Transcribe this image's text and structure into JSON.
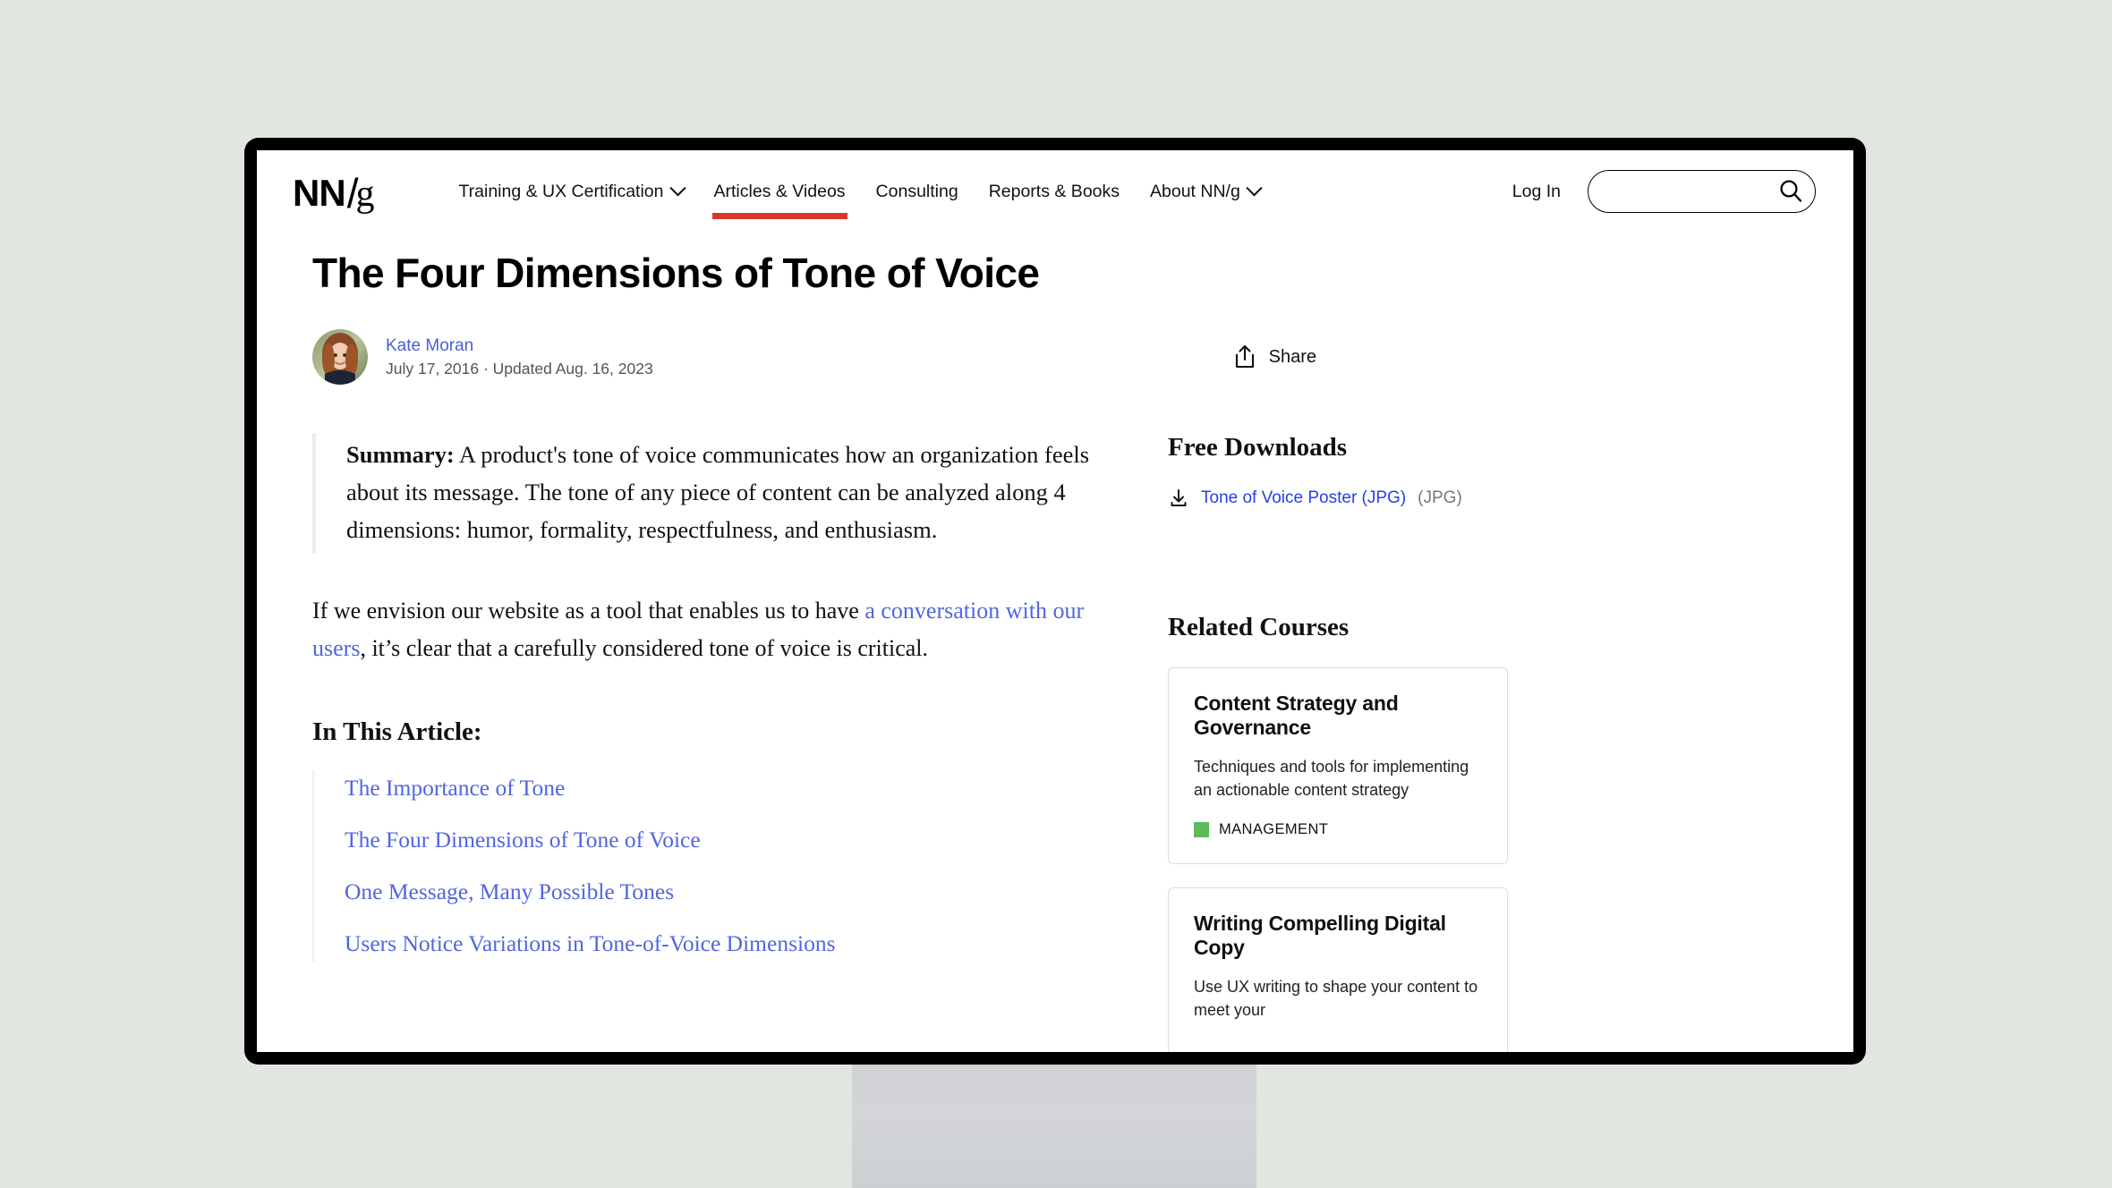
{
  "header": {
    "logo": {
      "n1": "N",
      "n2": "N",
      "slash": "/",
      "g": "g"
    },
    "nav": [
      {
        "label": "Training & UX Certification",
        "has_caret": true,
        "active": false
      },
      {
        "label": "Articles & Videos",
        "has_caret": false,
        "active": true
      },
      {
        "label": "Consulting",
        "has_caret": false,
        "active": false
      },
      {
        "label": "Reports & Books",
        "has_caret": false,
        "active": false
      },
      {
        "label": "About NN/g",
        "has_caret": true,
        "active": false
      }
    ],
    "login_label": "Log In",
    "search_placeholder": "",
    "search_value": "",
    "search_icon": "search-icon",
    "accent_color": "#d9372a"
  },
  "article": {
    "title": "The Four Dimensions of Tone of Voice",
    "author": "Kate Moran",
    "dates": "July 17, 2016 · Updated Aug. 16, 2023",
    "share_label": "Share",
    "summary_label": "Summary:",
    "summary_text": "A product's tone of voice communicates how an organization feels about its message. The tone of any piece of content can be analyzed along 4 dimensions: humor, formality, respectfulness, and enthusiasm.",
    "paragraph_1_before": "If we envision our website as a tool that enables us to have ",
    "paragraph_1_link": "a conversation with our users",
    "paragraph_1_after": ", it’s clear that a carefully considered tone of voice is critical.",
    "toc_heading": "In This Article:",
    "toc": [
      "The Importance of Tone",
      "The Four Dimensions of Tone of Voice",
      "One Message, Many Possible Tones",
      "Users Notice Variations in Tone-of-Voice Dimensions"
    ]
  },
  "sidebar": {
    "downloads_heading": "Free Downloads",
    "downloads": [
      {
        "link_label": "Tone of Voice Poster (JPG)",
        "type_label": "(JPG)",
        "icon": "download-icon"
      }
    ],
    "related_heading": "Related Courses",
    "courses": [
      {
        "title": "Content Strategy and Governance",
        "desc": "Techniques and tools for implementing an actionable content strategy",
        "tag": "MANAGEMENT",
        "tag_color": "#5dbb5d"
      },
      {
        "title": "Writing Compelling Digital Copy",
        "desc": "Use UX writing to shape your content to meet your",
        "tag": "",
        "tag_color": "#5dbb5d"
      }
    ]
  }
}
